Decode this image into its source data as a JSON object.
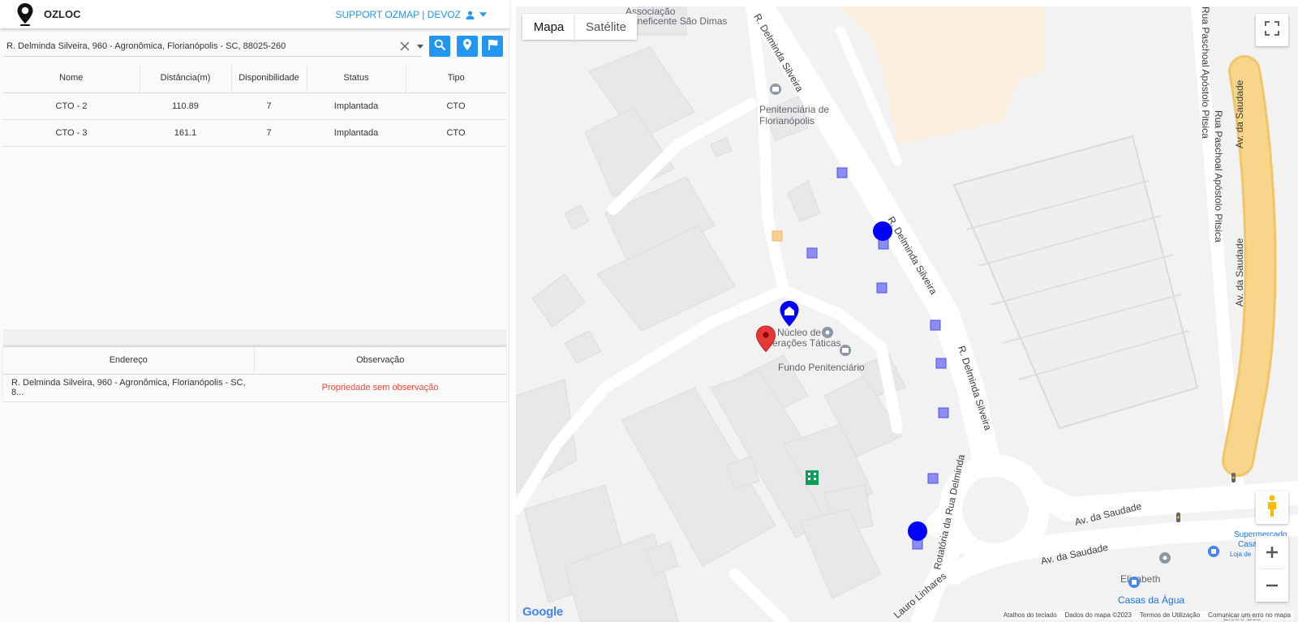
{
  "app": {
    "title": "OZLOC",
    "user_menu_label": "SUPPORT OZMAP | DEVOZ"
  },
  "search": {
    "value": "R. Delminda Silveira, 960 - Agronômica, Florianópolis - SC, 88025-260"
  },
  "cto_table": {
    "headers": [
      "Nome",
      "Distância(m)",
      "Disponibilidade",
      "Status",
      "Tipo"
    ],
    "rows": [
      [
        "CTO - 2",
        "110.89",
        "7",
        "Implantada",
        "CTO"
      ],
      [
        "CTO - 3",
        "161.1",
        "7",
        "Implantada",
        "CTO"
      ]
    ]
  },
  "address_table": {
    "headers": [
      "Endereço",
      "Observação"
    ],
    "rows": [
      [
        "R. Delminda Silveira, 960 - Agronômica, Florianópolis - SC, 8...",
        "Propriedade sem observação"
      ]
    ]
  },
  "map": {
    "type_buttons": [
      "Mapa",
      "Satélite"
    ],
    "labels": {
      "beneficente": "Beneficente São Dimas",
      "associacao": "Associação",
      "penitenciaria1": "Penitenciária de",
      "penitenciaria2": "Florianópolis",
      "nucleo1": "Núcleo de",
      "nucleo2": "Operações Táticas",
      "fundo": "Fundo Penitenciário",
      "delminda_top": "R. Delminda Silveira",
      "delminda_mid": "R. Delminda Silveira",
      "delminda_low": "R. Delminda Silveira",
      "rotatoria": "Rotatória da Rua Delminda",
      "saudade1": "Av. da Saudade",
      "saudade2": "Av. da Saudade",
      "saudade3": "Av. da Saudade",
      "saudade4": "Av. da Saudade",
      "pitsica1": "Rua Paschoal Apóstolo Pitsica",
      "pitsica2": "Rua Paschoal Apóstolo Pitsica",
      "lauro": "Lauro Linhares",
      "elizabeth": "Elizabeth",
      "casas_agua": "Casas da Água",
      "supermercado": "Supermercado",
      "casas": "Casas Bon",
      "loja": "Loja de",
      "eletro": "Eletro Bus"
    },
    "footer": [
      "Atalhos do teclado",
      "Dados do mapa ©2023",
      "Termos de Utilização",
      "Comunicar um erro no mapa"
    ],
    "google": "Google"
  },
  "colors": {
    "accent": "#2196f3",
    "marker_blue": "#0000ff",
    "marker_red": "#e53935",
    "observation": "#f44336",
    "road_yellow": "#f7d58a"
  }
}
